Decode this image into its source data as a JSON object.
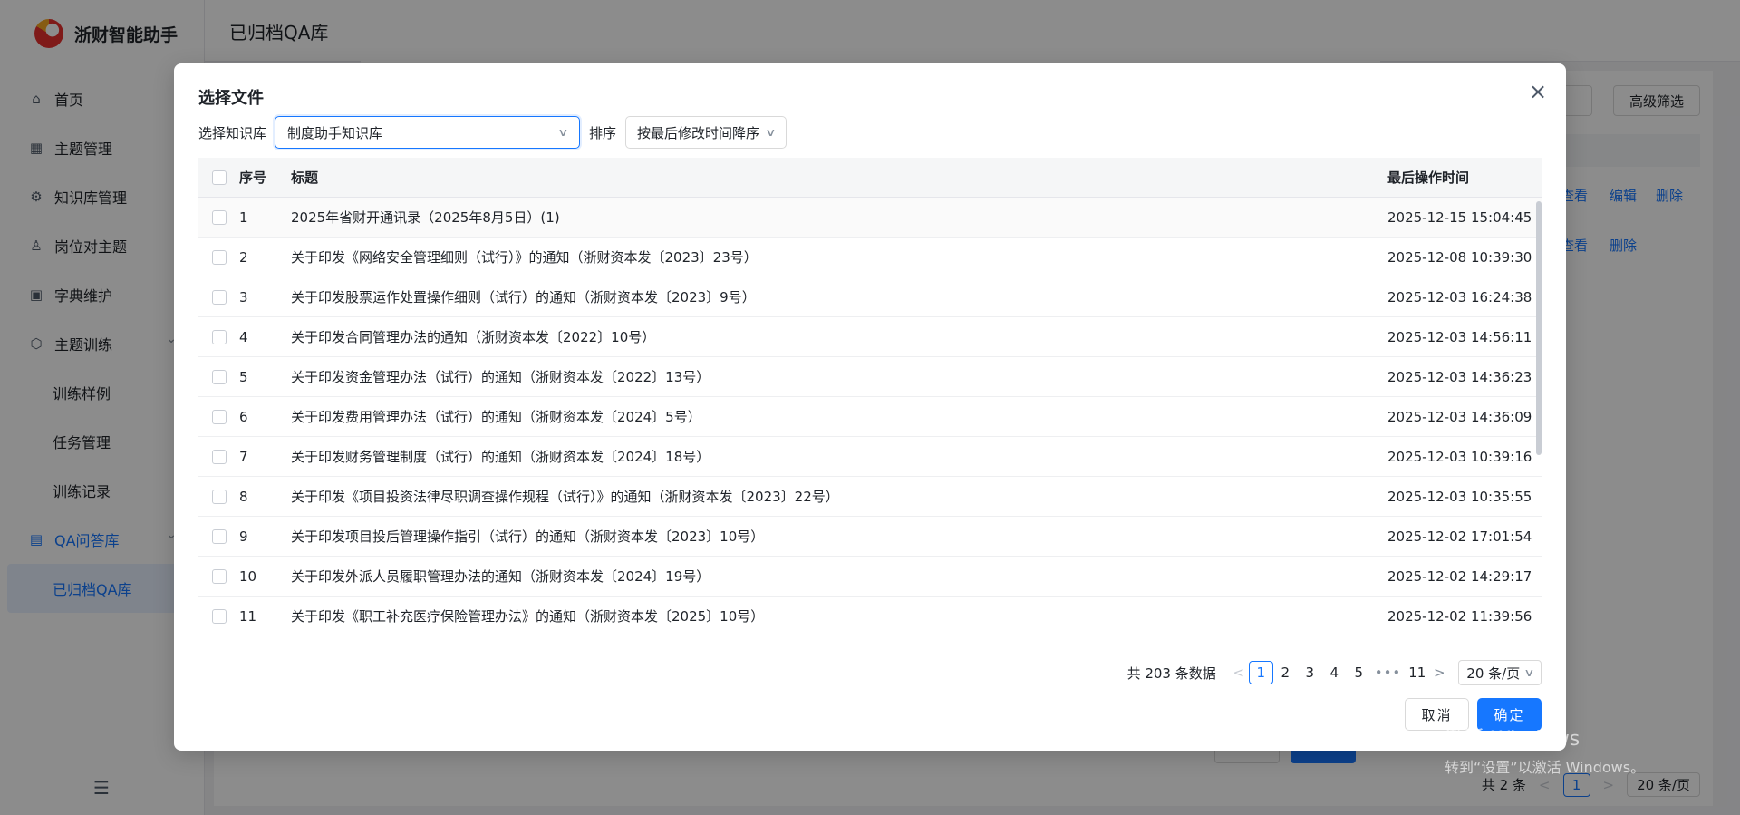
{
  "app": {
    "name": "浙财智能助手"
  },
  "sidebar": {
    "items": [
      {
        "label": "首页",
        "icon": "home-icon",
        "glyph": "⌂"
      },
      {
        "label": "主题管理",
        "icon": "grid-icon",
        "glyph": "▦"
      },
      {
        "label": "知识库管理",
        "icon": "sliders-icon",
        "glyph": "⚙"
      },
      {
        "label": "岗位对主题",
        "icon": "user-icon",
        "glyph": "♙"
      },
      {
        "label": "字典维护",
        "icon": "chart-icon",
        "glyph": "▣"
      },
      {
        "label": "主题训练",
        "icon": "cube-icon",
        "glyph": "⬡"
      },
      {
        "label": "训练样例"
      },
      {
        "label": "任务管理"
      },
      {
        "label": "训练记录"
      },
      {
        "label": "QA问答库",
        "icon": "chat-icon",
        "glyph": "▤"
      },
      {
        "label": "已归档QA库"
      }
    ],
    "collapse_glyph": "☰"
  },
  "header": {
    "title": "已归档QA库"
  },
  "background": {
    "advanced_filter": "高级筛选",
    "row1_actions": [
      "查看",
      "编辑",
      "删除"
    ],
    "row2_actions": [
      "查看",
      "删除"
    ],
    "pager_total": "共 2 条",
    "pager_current": "1",
    "pager_size": "20 条/页"
  },
  "modal": {
    "title": "选择文件",
    "close_glyph": "×",
    "kb_label": "选择知识库",
    "kb_value": "制度助手知识库",
    "sort_label": "排序",
    "sort_value": "按最后修改时间降序",
    "columns": {
      "index": "序号",
      "title": "标题",
      "time": "最后操作时间"
    },
    "rows": [
      {
        "no": "1",
        "title": "2025年省财开通讯录（2025年8月5日）(1)",
        "time": "2025-12-15 15:04:45"
      },
      {
        "no": "2",
        "title": "关于印发《网络安全管理细则（试行）》的通知（浙财资本发〔2023〕23号）",
        "time": "2025-12-08 10:39:30"
      },
      {
        "no": "3",
        "title": "关于印发股票运作处置操作细则（试行）的通知（浙财资本发〔2023〕9号）",
        "time": "2025-12-03 16:24:38"
      },
      {
        "no": "4",
        "title": "关于印发合同管理办法的通知（浙财资本发〔2022〕10号）",
        "time": "2025-12-03 14:56:11"
      },
      {
        "no": "5",
        "title": "关于印发资金管理办法（试行）的通知（浙财资本发〔2022〕13号）",
        "time": "2025-12-03 14:36:23"
      },
      {
        "no": "6",
        "title": "关于印发费用管理办法（试行）的通知（浙财资本发〔2024〕5号）",
        "time": "2025-12-03 14:36:09"
      },
      {
        "no": "7",
        "title": "关于印发财务管理制度（试行）的通知（浙财资本发〔2024〕18号）",
        "time": "2025-12-03 10:39:16"
      },
      {
        "no": "8",
        "title": "关于印发《项目投资法律尽职调查操作规程（试行）》的通知（浙财资本发〔2023〕22号）",
        "time": "2025-12-03 10:35:55"
      },
      {
        "no": "9",
        "title": "关于印发项目投后管理操作指引（试行）的通知（浙财资本发〔2023〕10号）",
        "time": "2025-12-02 17:01:54"
      },
      {
        "no": "10",
        "title": "关于印发外派人员履职管理办法的通知（浙财资本发〔2024〕19号）",
        "time": "2025-12-02 14:29:17"
      },
      {
        "no": "11",
        "title": "关于印发《职工补充医疗保险管理办法》的通知（浙财资本发〔2025〕10号）",
        "time": "2025-12-02 11:39:56"
      }
    ],
    "pagination": {
      "total": "共 203 条数据",
      "pages": [
        "1",
        "2",
        "3",
        "4",
        "5"
      ],
      "current": "1",
      "ellipsis": "•••",
      "last": "11",
      "page_size": "20 条/页",
      "prev_glyph": "<",
      "next_glyph": ">"
    },
    "cancel_label": "取消",
    "ok_label": "确定"
  },
  "watermark": {
    "line1": "激活 Windows",
    "line2": "转到“设置”以激活 Windows。"
  },
  "colors": {
    "primary": "#1677ff",
    "mask": "rgba(0,0,0,0.45)"
  }
}
